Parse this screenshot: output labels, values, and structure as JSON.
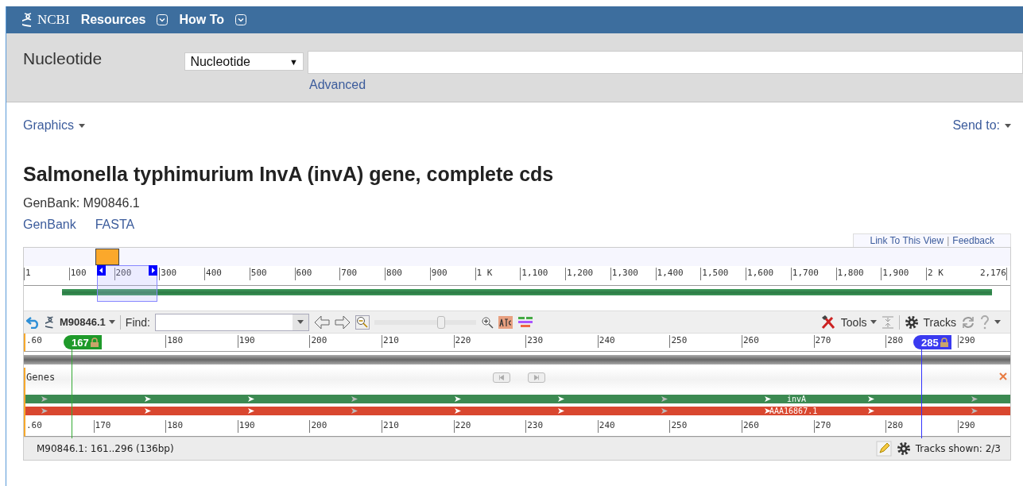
{
  "header": {
    "logo": "NCBI",
    "menus": [
      "Resources",
      "How To"
    ]
  },
  "search": {
    "database_label": "Nucleotide",
    "database_select": "Nucleotide",
    "select_arrow": "▼",
    "advanced_link": "Advanced"
  },
  "page": {
    "graphics_menu": "Graphics",
    "send_to": "Send to:",
    "title": "Salmonella typhimurium InvA (invA) gene, complete cds",
    "accession_line": "GenBank: M90846.1",
    "links": [
      "GenBank",
      "FASTA"
    ]
  },
  "viewer": {
    "view_links": [
      "Link To This View",
      "Feedback"
    ],
    "view_links_separator": "|",
    "overview_ruler": [
      "1",
      "100",
      "200",
      "300",
      "400",
      "500",
      "600",
      "700",
      "800",
      "900",
      "1 K",
      "1,100",
      "1,200",
      "1,300",
      "1,400",
      "1,500",
      "1,600",
      "1,700",
      "1,800",
      "1,900",
      "2 K",
      "2,176"
    ],
    "toolbar": {
      "sequence": "M90846.1",
      "find_label": "Find:",
      "zoom": {
        "level": 0.66
      },
      "tools": "Tools",
      "tracks": "Tracks"
    },
    "top_ruler": [
      ".60",
      "180",
      "190",
      "200",
      "210",
      "220",
      "230",
      "240",
      "250",
      "260",
      "270",
      "280",
      "290"
    ],
    "start_marker": {
      "label": "167",
      "color": "#1e9a2a"
    },
    "end_marker": {
      "label": "285",
      "color": "#3a3af0"
    },
    "track": {
      "name": "Genes",
      "features": [
        {
          "label": "invA",
          "color": "#3c8a52"
        },
        {
          "label": "AAA16867.1",
          "color": "#d9472f"
        }
      ]
    },
    "bottom_ruler": [
      ".60",
      "170",
      "180",
      "190",
      "200",
      "210",
      "220",
      "230",
      "240",
      "250",
      "260",
      "270",
      "280",
      "290"
    ],
    "status": {
      "range": "M90846.1: 161..296 (136bp)",
      "tracks_shown": "Tracks shown: 2/3"
    }
  }
}
